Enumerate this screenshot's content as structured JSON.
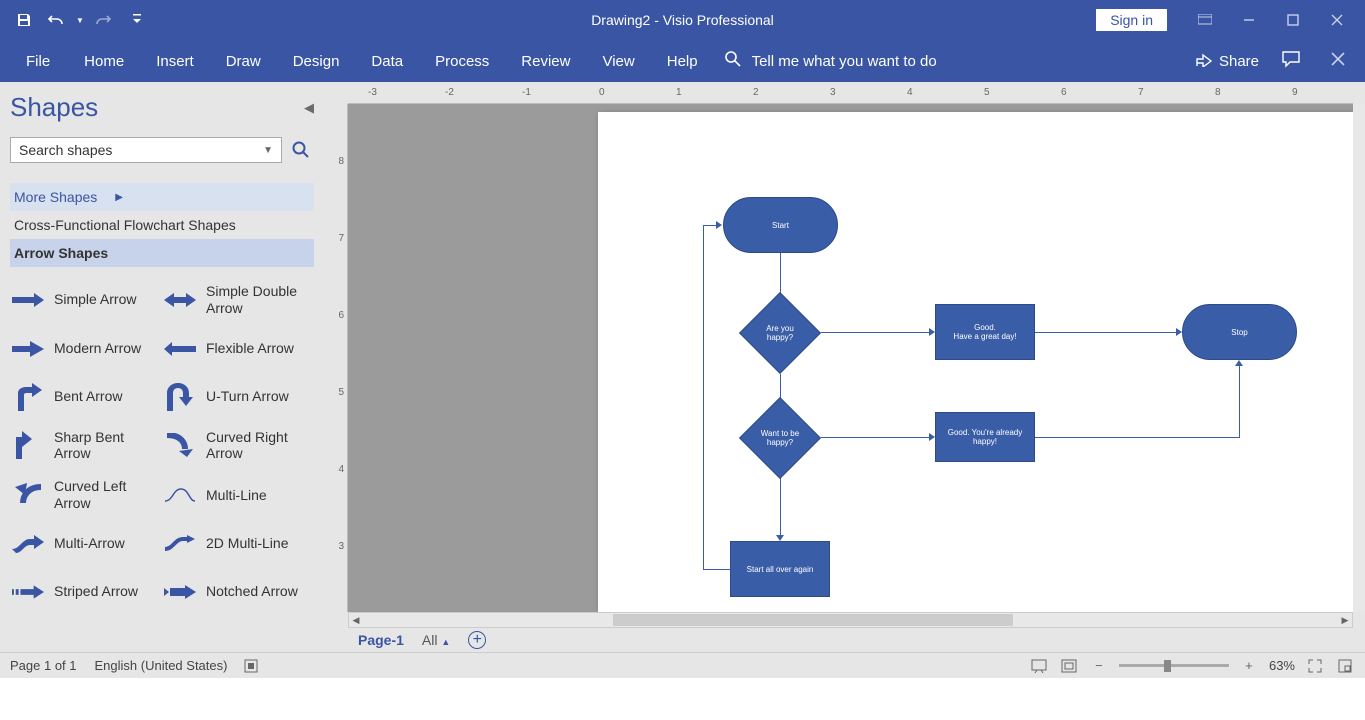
{
  "titlebar": {
    "title": "Drawing2  -  Visio Professional",
    "signin": "Sign in"
  },
  "ribbon": {
    "tabs": [
      "File",
      "Home",
      "Insert",
      "Draw",
      "Design",
      "Data",
      "Process",
      "Review",
      "View",
      "Help"
    ],
    "tellme": "Tell me what you want to do",
    "share": "Share"
  },
  "shapes": {
    "title": "Shapes",
    "search_placeholder": "Search shapes",
    "categories": {
      "more": "More Shapes",
      "cross": "Cross-Functional Flowchart Shapes",
      "arrow": "Arrow Shapes"
    },
    "items": [
      {
        "label": "Simple Arrow"
      },
      {
        "label": "Simple Double Arrow"
      },
      {
        "label": "Modern Arrow"
      },
      {
        "label": "Flexible Arrow"
      },
      {
        "label": "Bent Arrow"
      },
      {
        "label": "U-Turn Arrow"
      },
      {
        "label": "Sharp Bent Arrow"
      },
      {
        "label": "Curved Right Arrow"
      },
      {
        "label": "Curved Left Arrow"
      },
      {
        "label": "Multi-Line"
      },
      {
        "label": "Multi-Arrow"
      },
      {
        "label": "2D Multi-Line"
      },
      {
        "label": "Striped Arrow"
      },
      {
        "label": "Notched Arrow"
      }
    ]
  },
  "ruler": {
    "h": [
      "-3",
      "-2",
      "-1",
      "0",
      "1",
      "2",
      "3",
      "4",
      "5",
      "6",
      "7",
      "8",
      "9"
    ],
    "v": [
      "8",
      "7",
      "6",
      "5",
      "4",
      "3"
    ]
  },
  "flowchart": {
    "start": "Start",
    "happy": "Are you happy?",
    "good": "Good.\nHave a great day!",
    "stop": "Stop",
    "want": "Want to be happy?",
    "already": "Good. You're already happy!",
    "restart": "Start all over again"
  },
  "pagetabs": {
    "page1": "Page-1",
    "all": "All"
  },
  "statusbar": {
    "page": "Page 1 of 1",
    "lang": "English (United States)",
    "zoom": "63%"
  }
}
